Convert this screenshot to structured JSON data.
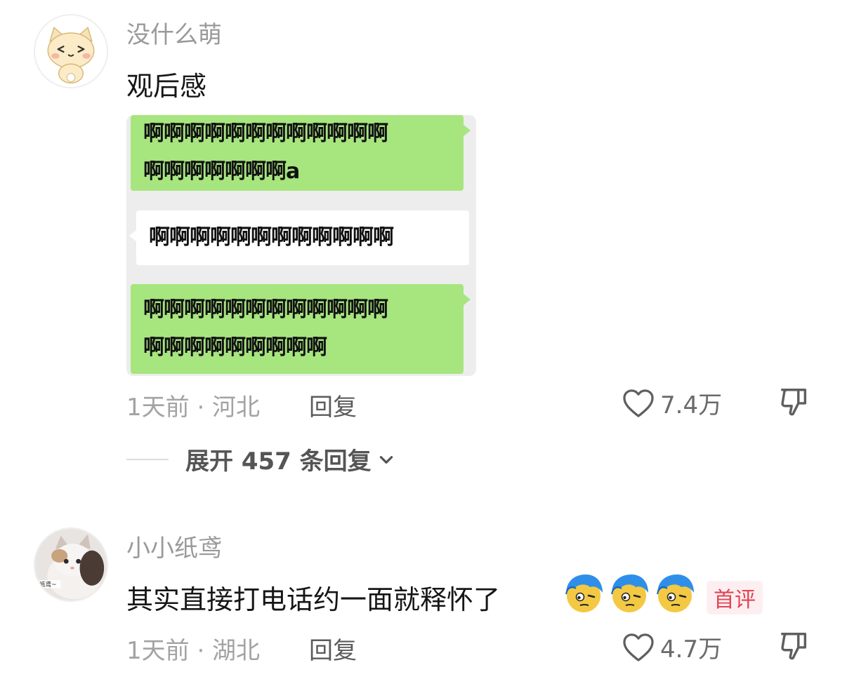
{
  "comments": [
    {
      "username": "没什么萌",
      "text": "观后感",
      "chat_image": {
        "bubbles": [
          {
            "side": "right",
            "lines": [
              "啊啊啊啊啊啊啊啊啊啊啊啊",
              "啊啊啊啊啊啊啊a"
            ]
          },
          {
            "side": "left",
            "lines": [
              "啊啊啊啊啊啊啊啊啊啊啊啊"
            ]
          },
          {
            "side": "right",
            "lines": [
              "啊啊啊啊啊啊啊啊啊啊啊啊",
              "啊啊啊啊啊啊啊啊啊"
            ]
          }
        ]
      },
      "time_location": "1天前 · 河北",
      "reply_label": "回复",
      "like_count": "7.4万",
      "expand_label": "展开 457 条回复"
    },
    {
      "username": "小小纸鸢",
      "avatar_caption": "纸鸢~",
      "text": "其实直接打电话约一面就释怀了",
      "emoji_count": 3,
      "badge": "首评",
      "time_location": "1天前 · 湖北",
      "reply_label": "回复",
      "like_count": "4.7万"
    }
  ],
  "icons": {
    "like": "heart-outline-icon",
    "dislike": "thumb-down-icon",
    "expand": "chevron-down-icon"
  },
  "colors": {
    "bubble_green": "#a7e57f",
    "badge_text": "#e34355",
    "badge_bg": "#fdeff1",
    "meta_gray": "#a3a3a3"
  }
}
